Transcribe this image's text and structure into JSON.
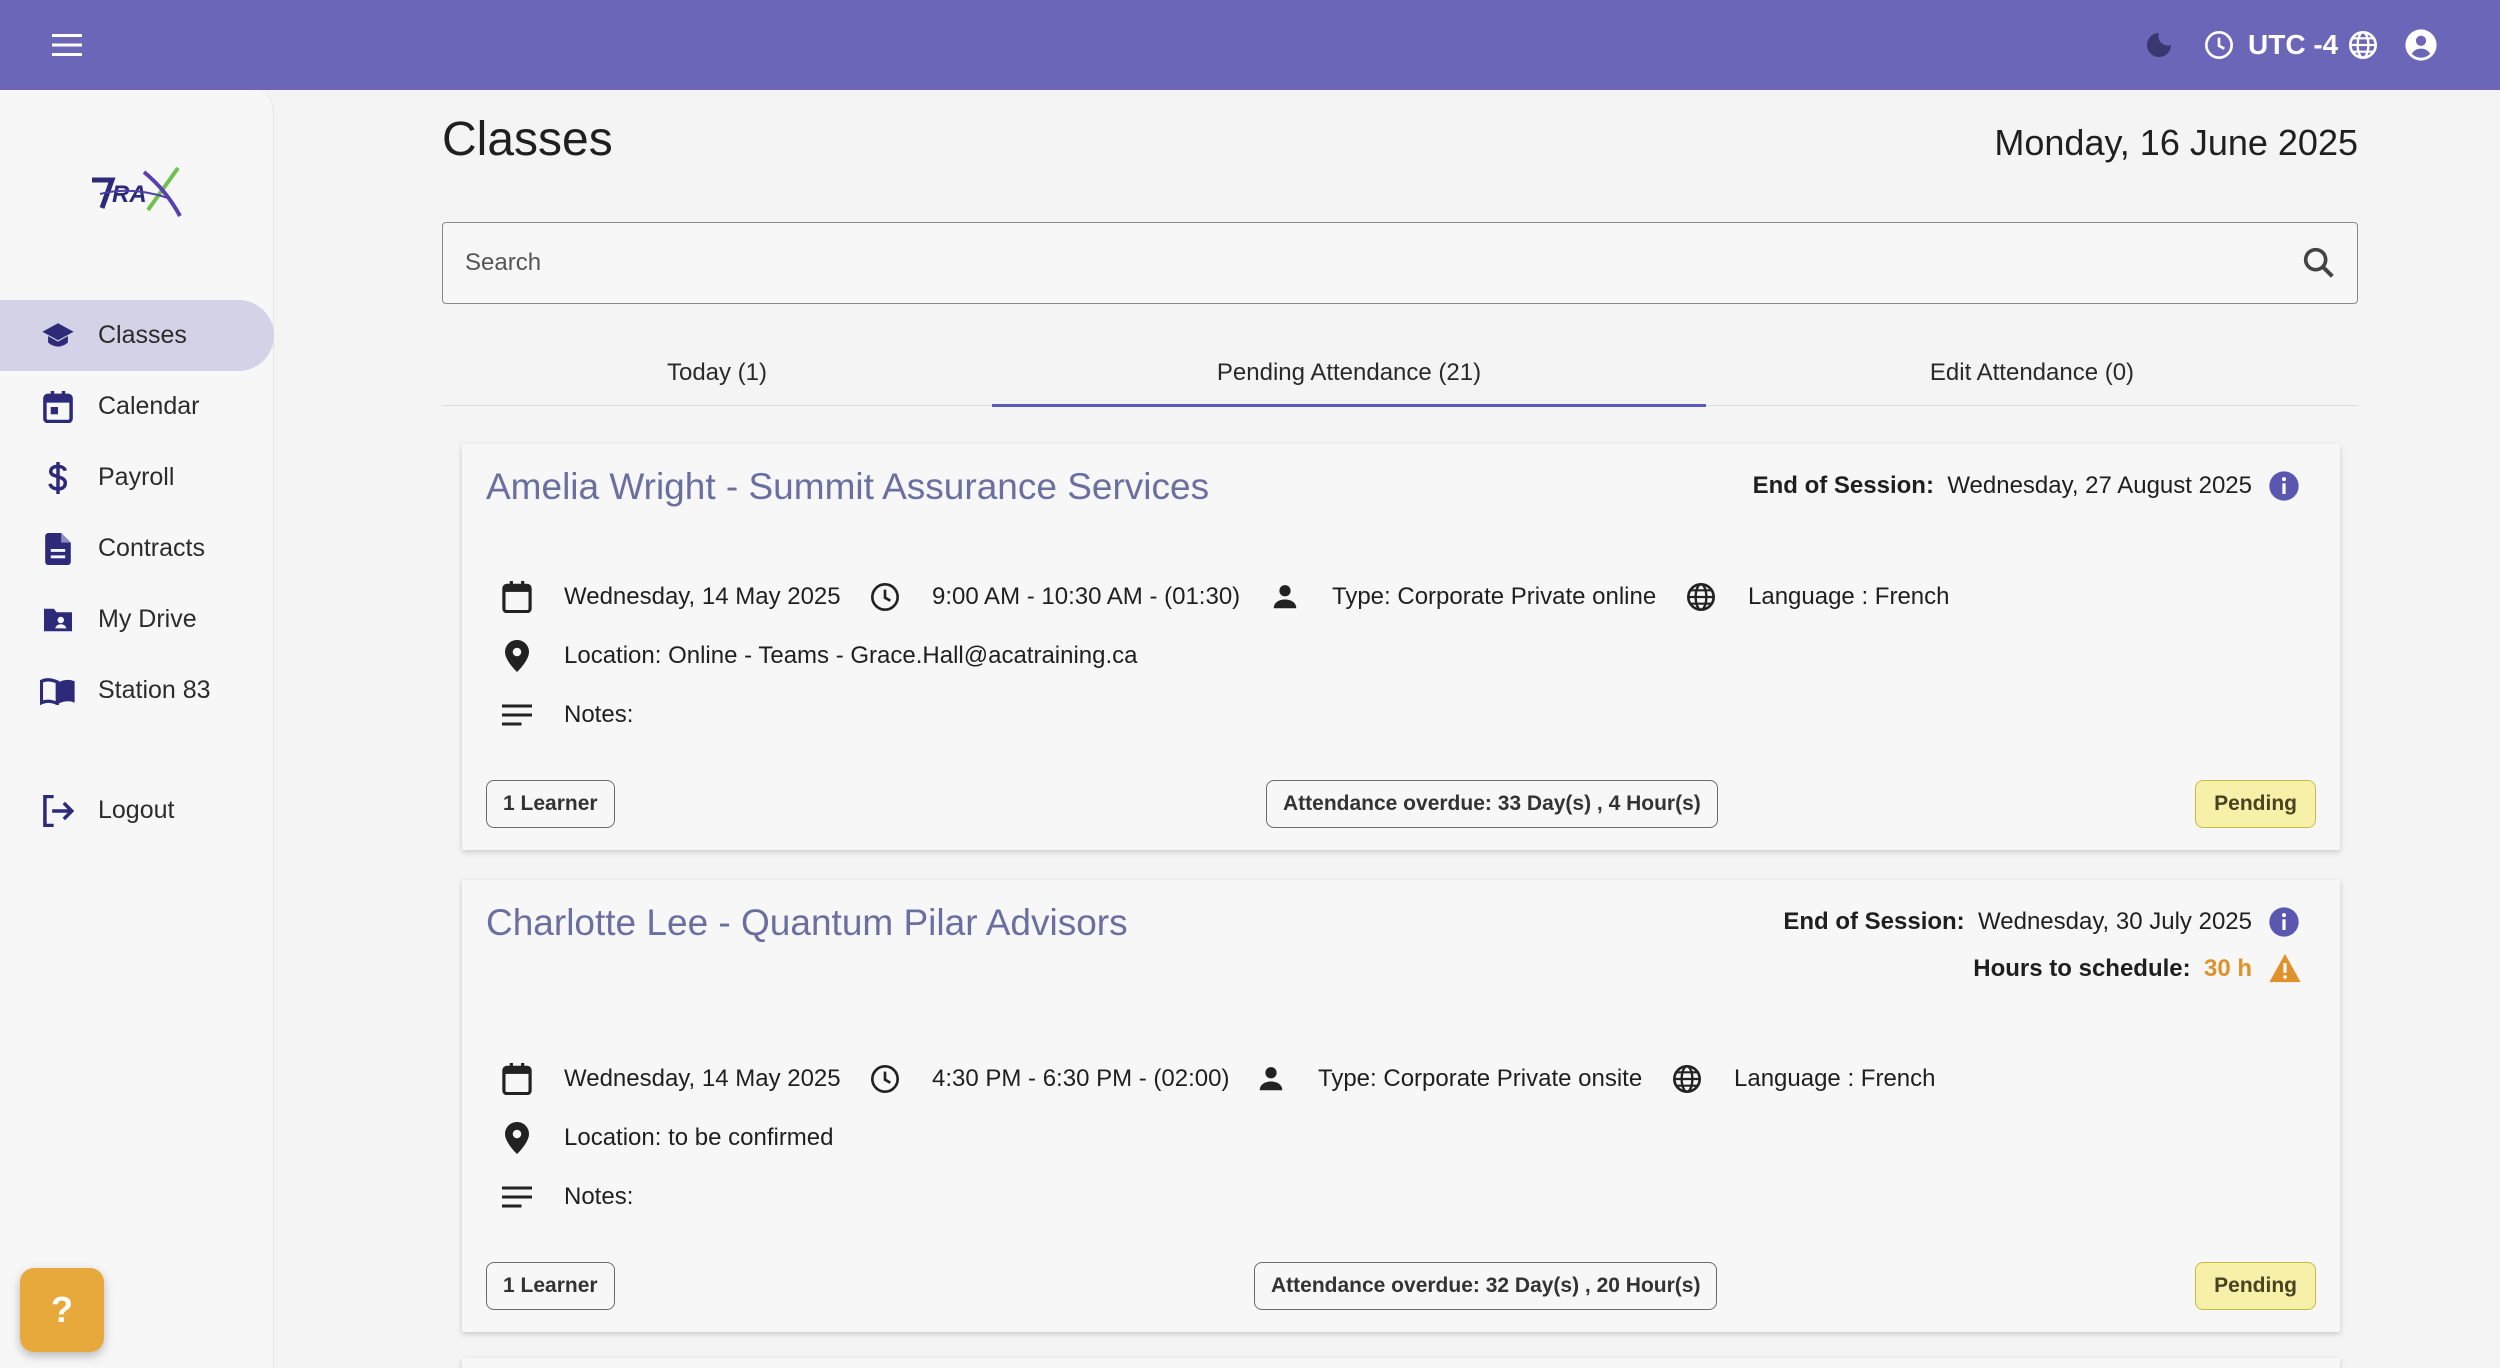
{
  "topbar": {
    "timezone": "UTC -4",
    "icons": [
      "menu-icon",
      "moon-icon",
      "clock-icon",
      "globe-icon",
      "account-icon"
    ],
    "color": "#6b66b7"
  },
  "sidebar": {
    "items": [
      {
        "label": "Classes",
        "icon": "school-icon",
        "active": true
      },
      {
        "label": "Calendar",
        "icon": "calendar-icon"
      },
      {
        "label": "Payroll",
        "icon": "dollar-icon"
      },
      {
        "label": "Contracts",
        "icon": "document-icon"
      },
      {
        "label": "My Drive",
        "icon": "folder-icon"
      },
      {
        "label": "Station 83",
        "icon": "book-icon"
      },
      {
        "label": "Logout",
        "icon": "logout-icon"
      }
    ],
    "help_label": "?"
  },
  "main": {
    "title": "Classes",
    "date": "Monday, 16 June 2025",
    "search": {
      "placeholder": "Search",
      "value": ""
    },
    "tabs": [
      {
        "label": "Today (1)"
      },
      {
        "label": "Pending Attendance (21)",
        "active": true
      },
      {
        "label": "Edit Attendance (0)"
      }
    ],
    "cards": [
      {
        "title": "Amelia Wright - Summit Assurance Services",
        "eos_label": "End of Session:",
        "eos_value": "Wednesday, 27 August 2025",
        "date": "Wednesday, 14 May 2025",
        "time": "9:00 AM - 10:30 AM - (01:30)",
        "type": "Type: Corporate Private online",
        "language": "Language : French",
        "location": "Location: Online - Teams - Grace.Hall@acatraining.ca",
        "notes": "Notes:",
        "learners": "1 Learner",
        "overdue": "Attendance overdue: 33 Day(s) , 4 Hour(s)",
        "status": "Pending"
      },
      {
        "title": "Charlotte Lee - Quantum Pilar Advisors",
        "eos_label": "End of Session:",
        "eos_value": "Wednesday, 30 July 2025",
        "hours_label": "Hours to schedule:",
        "hours_value": "30 h",
        "date": "Wednesday, 14 May 2025",
        "time": "4:30 PM - 6:30 PM - (02:00)",
        "type": "Type: Corporate Private onsite",
        "language": "Language : French",
        "location": "Location: to be confirmed",
        "notes": "Notes:",
        "learners": "1 Learner",
        "overdue": "Attendance overdue: 32 Day(s) , 20 Hour(s)",
        "status": "Pending"
      }
    ]
  },
  "colors": {
    "accent": "#5b5bb5",
    "warning": "#e0912a",
    "pending_bg": "#f7f0a9",
    "help": "#e7a93c"
  }
}
